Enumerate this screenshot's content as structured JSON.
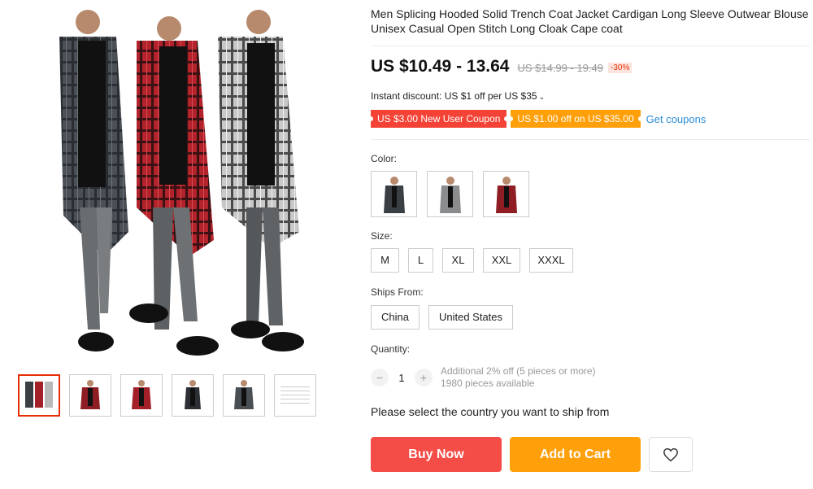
{
  "product": {
    "title": "Men Splicing Hooded Solid Trench Coat Jacket Cardigan Long Sleeve Outwear Blouse Unisex Casual Open Stitch Long Cloak Cape coat"
  },
  "pricing": {
    "price": "US $10.49 - 13.64",
    "original_price": "US $14.99 - 19.49",
    "discount": "-30%",
    "instant_discount": "Instant discount: US $1 off per US $35"
  },
  "coupons": {
    "new_user": "US $3.00 New User Coupon",
    "off": "US $1.00 off on US $35.00",
    "get_coupons": "Get coupons"
  },
  "options": {
    "color_label": "Color:",
    "colors": [
      {
        "name": "dark-plaid",
        "icon": "coat-thumbnail",
        "color": "#3a3f44"
      },
      {
        "name": "grey-plaid",
        "icon": "coat-thumbnail",
        "color": "#8a8c8e"
      },
      {
        "name": "red-plaid",
        "icon": "coat-thumbnail",
        "color": "#8e1e24"
      }
    ],
    "size_label": "Size:",
    "sizes": [
      "M",
      "L",
      "XL",
      "XXL",
      "XXXL"
    ],
    "ships_label": "Ships From:",
    "ships_from": [
      "China",
      "United States"
    ],
    "quantity_label": "Quantity:",
    "quantity": "1",
    "qty_minus": "−",
    "qty_plus": "+",
    "qty_info_1": "Additional 2% off (5 pieces or more)",
    "qty_info_2": "1980 pieces available"
  },
  "ship_note": "Please select the country you want to ship from",
  "actions": {
    "buy_now": "Buy Now",
    "add_to_cart": "Add to Cart",
    "wishlist_icon": "heart-icon"
  },
  "colors": {
    "accent_red": "#f44c46",
    "accent_orange": "#ff9f0a",
    "link_blue": "#2b8fd6"
  }
}
